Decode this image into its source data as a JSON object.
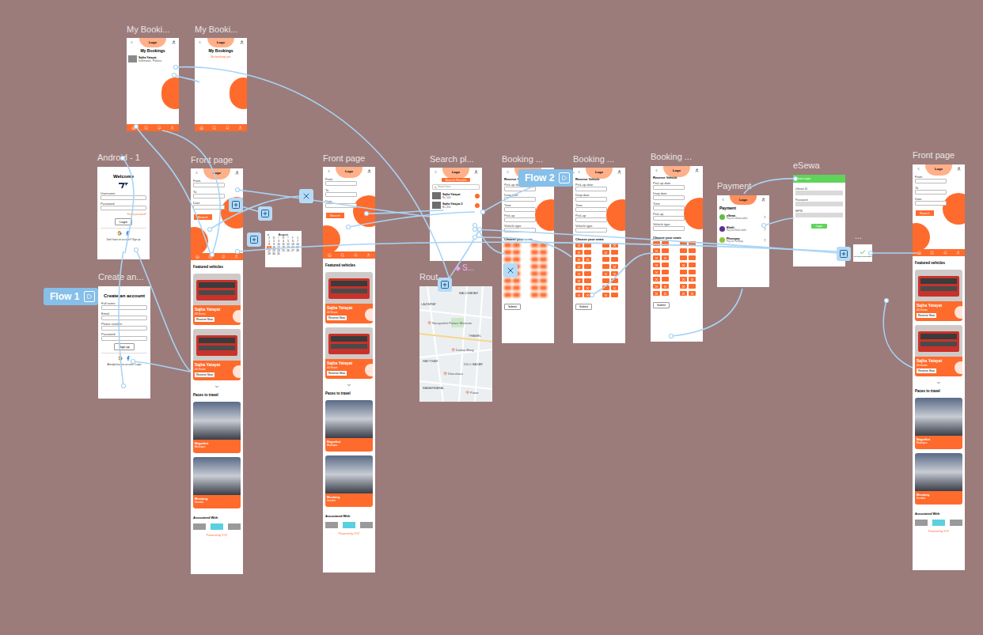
{
  "canvas": {
    "flows": [
      {
        "label": "Flow 1"
      },
      {
        "label": "Flow 2"
      }
    ],
    "chips": [
      {
        "label": "S..."
      }
    ]
  },
  "frames": [
    {
      "label": "My Booki...",
      "kind": "bookings",
      "logo": "Logo",
      "title": "My Bookings",
      "items": [
        {
          "name": "Sajha Yatayat",
          "detail": "Kathmandu - Pokhara"
        }
      ]
    },
    {
      "label": "My Booki...",
      "kind": "bookings",
      "logo": "Logo",
      "title": "My Bookings",
      "items": [],
      "message": "No bookings yet"
    },
    {
      "label": "Android - 1",
      "kind": "auth",
      "title": "Welcome",
      "fields": [
        "Username",
        "Password"
      ],
      "link": "Forgot password?",
      "button": "Login",
      "footer": "Don't have an account? Sign up"
    },
    {
      "label": "Create an...",
      "kind": "auth",
      "title": "Create an account",
      "fields": [
        "Full name",
        "Email",
        "Phone number",
        "Password"
      ],
      "button": "Sign up",
      "footer": "Already have an account? Login"
    },
    {
      "label": "Front page",
      "kind": "home",
      "logo": "Logo",
      "fields": [
        "From",
        "To",
        "Date"
      ],
      "button": "Search",
      "featured_title": "Featured vehicles",
      "vehicles": [
        {
          "name": "Sajha Yatayat",
          "meta": "40 Seats",
          "button": "Reserve Now"
        },
        {
          "name": "Sajha Yatayat",
          "meta": "40 Seats",
          "button": "Reserve Now"
        }
      ],
      "places_title": "Paces to travel",
      "places": [
        {
          "name": "Nagarkot",
          "sub": "Bhaktapur"
        },
        {
          "name": "Mustang",
          "sub": "Gandaki"
        }
      ],
      "partners_title": "Associated With",
      "footer": "Powered by XYZ"
    },
    {
      "label": "Front page",
      "kind": "home",
      "logo": "Logo",
      "fields": [
        "From",
        "To",
        "Date"
      ],
      "button": "Search",
      "featured_title": "Featured vehicles",
      "vehicles": [
        {
          "name": "Sajha Yatayat",
          "meta": "40 Seats",
          "button": "Reserve Now"
        },
        {
          "name": "Sajha Yatayat",
          "meta": "40 Seats",
          "button": "Reserve Now"
        }
      ],
      "places_title": "Paces to travel",
      "places": [
        {
          "name": "Nagarkot",
          "sub": "Bhaktapur"
        },
        {
          "name": "Mustang",
          "sub": "Gandaki"
        }
      ],
      "partners_title": "Associated With",
      "footer": "Powered by XYZ"
    },
    {
      "label": "Search pl...",
      "kind": "search",
      "logo": "Logo",
      "title": "Search Results",
      "placeholder": "Search here",
      "results": [
        {
          "name": "Sajha Yatayat",
          "sub": "Rs. 500"
        },
        {
          "name": "Sajha Yatayat 2",
          "sub": "Rs. 450"
        }
      ]
    },
    {
      "label": "Rout...",
      "kind": "map",
      "places": [
        {
          "name": "LAZIMPAT",
          "pin": false
        },
        {
          "name": "BALUWATAR",
          "pin": false
        },
        {
          "name": "Narayanhiti Palace Museum",
          "pin": true
        },
        {
          "name": "THAMEL",
          "pin": false
        },
        {
          "name": "Durbar Marg",
          "pin": true
        },
        {
          "name": "HATTISAR",
          "pin": false
        },
        {
          "name": "Dharahara",
          "pin": true
        },
        {
          "name": "DILLI BAZAR",
          "pin": false
        },
        {
          "name": "BABARMAHAL",
          "pin": false
        },
        {
          "name": "Patan",
          "pin": true
        }
      ]
    },
    {
      "kind": "calendar",
      "month": "August",
      "weekdays": [
        "S",
        "M",
        "T",
        "W",
        "T",
        "F",
        "S"
      ],
      "days": [
        {
          "day": "1",
          "selected": false
        },
        {
          "day": "2",
          "selected": false
        },
        {
          "day": "3",
          "selected": false
        },
        {
          "day": "4",
          "selected": false
        },
        {
          "day": "5",
          "selected": false
        },
        {
          "day": "6",
          "selected": false
        },
        {
          "day": "7",
          "selected": false
        },
        {
          "day": "8",
          "selected": false
        },
        {
          "day": "9",
          "selected": false
        },
        {
          "day": "10",
          "selected": false
        },
        {
          "day": "11",
          "selected": false
        },
        {
          "day": "12",
          "selected": false
        },
        {
          "day": "13",
          "selected": false
        },
        {
          "day": "14",
          "selected": false
        },
        {
          "day": "15",
          "selected": true
        },
        {
          "day": "16",
          "selected": false
        },
        {
          "day": "17",
          "selected": false
        },
        {
          "day": "18",
          "selected": false
        },
        {
          "day": "19",
          "selected": false
        },
        {
          "day": "20",
          "selected": false
        },
        {
          "day": "21",
          "selected": false
        },
        {
          "day": "22",
          "selected": false
        },
        {
          "day": "23",
          "selected": false
        },
        {
          "day": "24",
          "selected": false
        },
        {
          "day": "25",
          "selected": false
        },
        {
          "day": "26",
          "selected": false
        },
        {
          "day": "27",
          "selected": false
        },
        {
          "day": "28",
          "selected": false
        },
        {
          "day": "29",
          "selected": false
        },
        {
          "day": "30",
          "selected": false
        },
        {
          "day": "31",
          "selected": false
        }
      ]
    },
    {
      "label": "Booking ...",
      "kind": "booking",
      "logo": "Logo",
      "title": "Reserve Vehicle",
      "fields": [
        "Pick-up date",
        "Drop date",
        "Time",
        "Pick-up",
        "Vehicle type"
      ],
      "seats_title": "Choose your seats",
      "blurred": true,
      "seat_rows": [
        [
          false,
          false,
          false,
          false
        ],
        [
          false,
          false,
          false,
          false
        ],
        [
          false,
          false,
          false,
          false
        ],
        [
          false,
          false,
          false,
          false
        ],
        [
          false,
          false,
          false,
          false
        ],
        [
          false,
          false,
          false,
          false
        ],
        [
          false,
          false,
          false,
          false
        ],
        [
          false,
          false,
          false,
          false
        ]
      ],
      "button": "Submit"
    },
    {
      "label": "Booking ...",
      "kind": "booking",
      "logo": "Logo",
      "title": "Reserve Vehicle",
      "fields": [
        "Pick-up date",
        "Drop date",
        "Time",
        "Pick-up",
        "Vehicle type"
      ],
      "seats_title": "Choose your seats",
      "blurred": false,
      "seat_rows": [
        [
          true,
          false,
          false,
          true
        ],
        [
          true,
          false,
          true,
          false
        ],
        [
          true,
          true,
          false,
          false
        ],
        [
          true,
          false,
          false,
          true
        ],
        [
          true,
          false,
          true,
          true
        ],
        [
          true,
          false,
          false,
          false
        ],
        [
          true,
          true,
          false,
          true
        ],
        [
          true,
          true,
          true,
          false
        ]
      ],
      "button": "Submit"
    },
    {
      "label": "Booking ...",
      "kind": "booking",
      "logo": "Logo",
      "title": "Reserve Vehicle",
      "fields": [
        "Pick-up date",
        "Drop date",
        "Time",
        "Pick-up",
        "Vehicle type"
      ],
      "seats_title": "Choose your seats",
      "blurred": false,
      "seat_rows": [
        [
          false,
          false,
          false,
          false
        ],
        [
          true,
          false,
          false,
          false
        ],
        [
          true,
          true,
          false,
          false
        ],
        [
          true,
          false,
          true,
          false
        ],
        [
          true,
          false,
          false,
          false
        ],
        [
          true,
          false,
          true,
          true
        ],
        [
          true,
          true,
          true,
          false
        ],
        [
          true,
          true,
          true,
          true
        ]
      ],
      "button": "Submit"
    },
    {
      "label": "Payment",
      "kind": "payment",
      "logo": "Logo",
      "title": "Payment",
      "options": [
        {
          "name": "eSewa",
          "sub": "Pay via eSewa wallet",
          "color": "#60bb46"
        },
        {
          "name": "Khalti",
          "sub": "Pay via Khalti wallet",
          "color": "#5c2d91"
        },
        {
          "name": "Phonepay",
          "sub": "Pay via Fonepay",
          "color": "#8dc63f"
        }
      ]
    },
    {
      "label": "eSewa",
      "kind": "esewa",
      "header": "eSewa Login",
      "fields": [
        "eSewa ID",
        "Password",
        "MPIN"
      ],
      "button": "Login"
    },
    {
      "label": "...",
      "kind": "success",
      "message": "Payment Successful"
    },
    {
      "label": "Front page",
      "kind": "home",
      "logo": "Logo",
      "fields": [
        "From",
        "To",
        "Date"
      ],
      "button": "Search",
      "featured_title": "Featured vehicles",
      "vehicles": [
        {
          "name": "Sajha Yatayat",
          "meta": "40 Seats",
          "button": "Reserve Now"
        },
        {
          "name": "Sajha Yatayat",
          "meta": "40 Seats",
          "button": "Reserve Now"
        }
      ],
      "places_title": "Paces to travel",
      "places": [
        {
          "name": "Nagarkot",
          "sub": "Bhaktapur"
        },
        {
          "name": "Mustang",
          "sub": "Gandaki"
        }
      ],
      "partners_title": "Associated With",
      "footer": "Powered by XYZ"
    }
  ]
}
